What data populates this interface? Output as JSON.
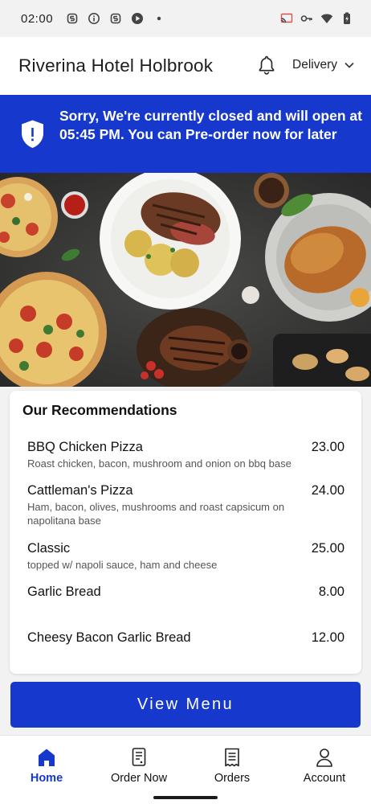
{
  "status_bar": {
    "time": "02:00",
    "left_icons": [
      "notification-s-icon",
      "info-icon",
      "notification-s-icon",
      "play-icon",
      "dot-icon"
    ],
    "right_icons": [
      "cast-icon",
      "vpn-key-icon",
      "wifi-icon",
      "battery-charging-icon"
    ]
  },
  "header": {
    "title": "Riverina Hotel Holbrook",
    "notification_icon": "bell-icon",
    "mode_label": "Delivery"
  },
  "banner": {
    "icon": "shield-alert-icon",
    "message": "Sorry, We're currently closed and will open at 05:45 PM. You can Pre-order now for later"
  },
  "hero": {
    "image": "food-spread-photo"
  },
  "recommendations": {
    "title": "Our Recommendations",
    "items": [
      {
        "name": "BBQ Chicken Pizza",
        "price": "23.00",
        "description": "Roast chicken, bacon, mushroom and onion on bbq base"
      },
      {
        "name": "Cattleman's Pizza",
        "price": "24.00",
        "description": "Ham, bacon, olives, mushrooms and roast capsicum on napolitana base"
      },
      {
        "name": "Classic",
        "price": "25.00",
        "description": "topped w/ napoli sauce, ham and cheese"
      },
      {
        "name": "Garlic Bread",
        "price": "8.00",
        "description": ""
      },
      {
        "name": "Cheesy Bacon Garlic Bread",
        "price": "12.00",
        "description": ""
      }
    ]
  },
  "view_menu_label": "View Menu",
  "colors": {
    "primary": "#1638cc",
    "background": "#f2f2f2"
  },
  "bottom_nav": {
    "items": [
      {
        "label": "Home",
        "icon": "home-icon",
        "active": true
      },
      {
        "label": "Order Now",
        "icon": "order-receipt-icon",
        "active": false
      },
      {
        "label": "Orders",
        "icon": "orders-list-icon",
        "active": false
      },
      {
        "label": "Account",
        "icon": "account-person-icon",
        "active": false
      }
    ]
  }
}
